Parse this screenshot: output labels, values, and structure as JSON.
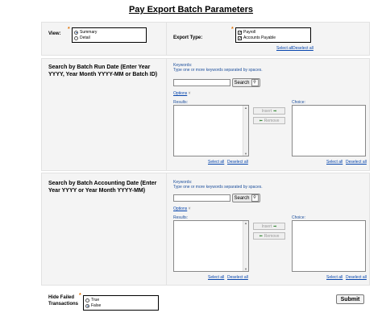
{
  "page": {
    "title": "Pay Export Batch Parameters"
  },
  "view": {
    "label": "View:",
    "options": [
      {
        "label": "Summary",
        "selected": true
      },
      {
        "label": "Detail",
        "selected": false
      }
    ]
  },
  "export_type": {
    "label": "Export Type:",
    "options": [
      {
        "label": "Payroll",
        "checked": true
      },
      {
        "label": "Accounts Payable",
        "checked": true
      }
    ],
    "select_all": "Select all",
    "deselect_all": "Deselect all"
  },
  "run_date": {
    "title": "Search by Batch Run Date (Enter Year YYYY, Year Month YYYY-MM or Batch ID)",
    "keywords_label": "Keywords:",
    "keywords_hint": "Type one or more keywords separated by spaces.",
    "keywords_value": "",
    "search_label": "Search",
    "options_label": "Options",
    "results_label": "Results:",
    "choice_label": "Choice:",
    "insert_label": "Insert",
    "remove_label": "Remove",
    "select_all": "Select all",
    "deselect_all": "Deselect all"
  },
  "accounting_date": {
    "title": "Search by Batch Accounting Date (Enter Year YYYY or Year Month YYYY-MM)",
    "keywords_label": "Keywords:",
    "keywords_hint": "Type one or more keywords separated by spaces.",
    "keywords_value": "",
    "search_label": "Search",
    "options_label": "Options",
    "results_label": "Results:",
    "choice_label": "Choice:",
    "insert_label": "Insert",
    "remove_label": "Remove",
    "select_all": "Select all",
    "deselect_all": "Deselect all"
  },
  "hide_failed": {
    "label": "Hide Failed Transactions",
    "options": [
      {
        "label": "True",
        "selected": false
      },
      {
        "label": "False",
        "selected": true
      }
    ]
  },
  "submit": {
    "label": "Submit"
  },
  "icons": {
    "search": "magnifier-icon",
    "insert": "arrow-right-icon",
    "remove": "arrow-left-icon",
    "options": "chevron-down-icon"
  }
}
